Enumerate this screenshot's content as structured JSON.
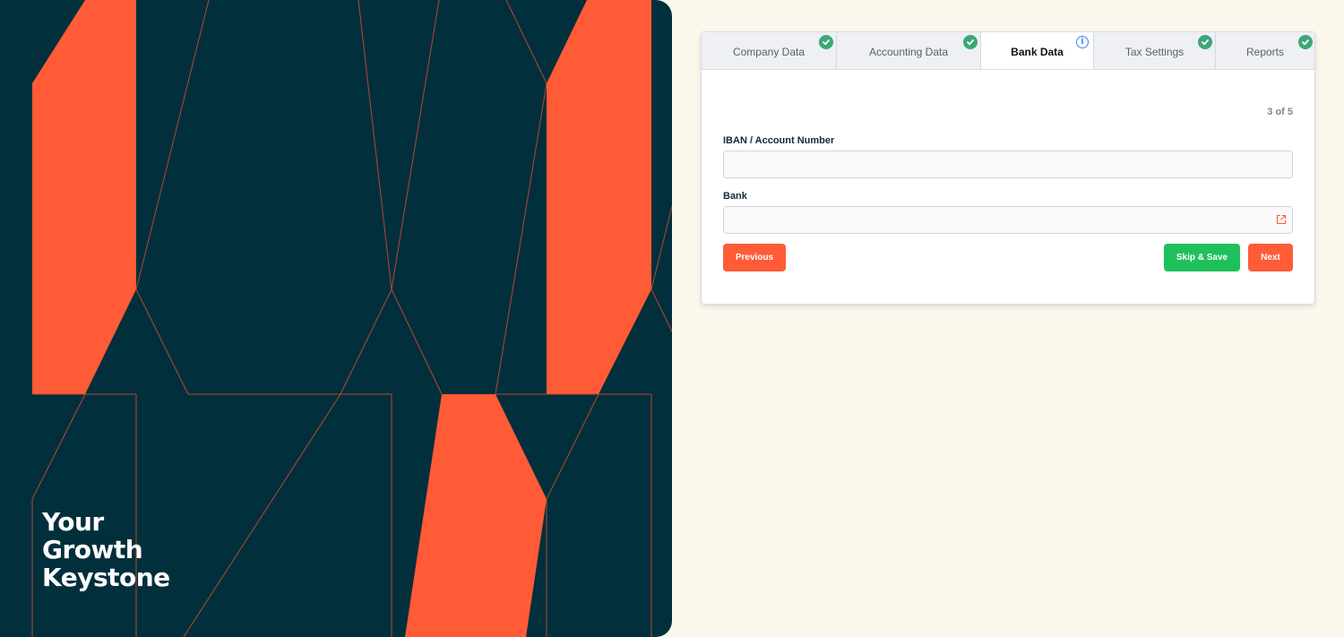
{
  "hero": {
    "tagline": [
      "Your",
      "Growth",
      "Keystone"
    ]
  },
  "tabs": [
    {
      "label": "Company Data",
      "status": "complete"
    },
    {
      "label": "Accounting Data",
      "status": "complete"
    },
    {
      "label": "Bank Data",
      "status": "active-info"
    },
    {
      "label": "Tax Settings",
      "status": "complete"
    },
    {
      "label": "Reports",
      "status": "complete"
    }
  ],
  "form": {
    "step": "3 of 5",
    "iban_label": "IBAN / Account Number",
    "iban_value": "",
    "bank_label": "Bank",
    "bank_value": ""
  },
  "buttons": {
    "previous": "Previous",
    "skip_save": "Skip & Save",
    "next": "Next"
  },
  "colors": {
    "hero_bg": "#022f3c",
    "accent_orange": "#ff5b36",
    "success_green": "#1fc05b",
    "check_green": "#3da77a",
    "info_blue": "#3b82f6",
    "page_bg": "#fbf7ec"
  },
  "icons": {
    "tab_complete": "check-circle-icon",
    "tab_active": "info-circle-icon",
    "bank_field": "external-link-icon"
  }
}
